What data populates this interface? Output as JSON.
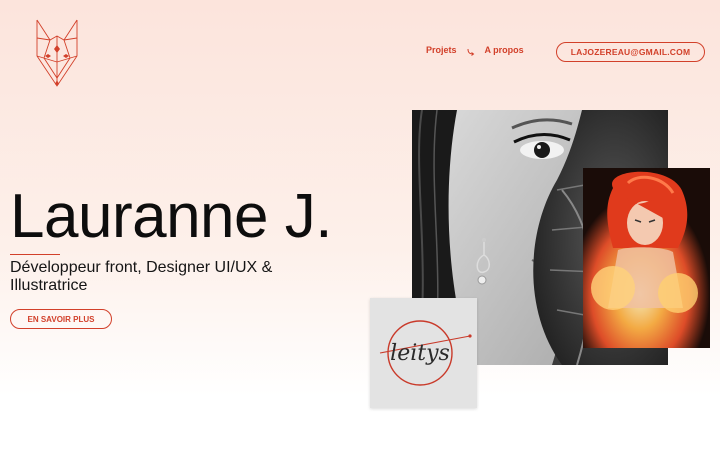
{
  "nav": {
    "projects": "Projets",
    "about": "A propos",
    "email": "LAJOZEREAU@GMAIL.COM"
  },
  "hero": {
    "name": "Lauranne J.",
    "subtitle": "Développeur front, Designer UI/UX & Illustratrice",
    "cta": "EN SAVOIR PLUS"
  },
  "signature": "leitys",
  "colors": {
    "accent": "#d2402a",
    "background_top": "#fce4dc",
    "text": "#0d0d0d"
  },
  "icons": {
    "logo": "fox-logo-icon",
    "nav_arrow": "curved-arrow-icon"
  }
}
